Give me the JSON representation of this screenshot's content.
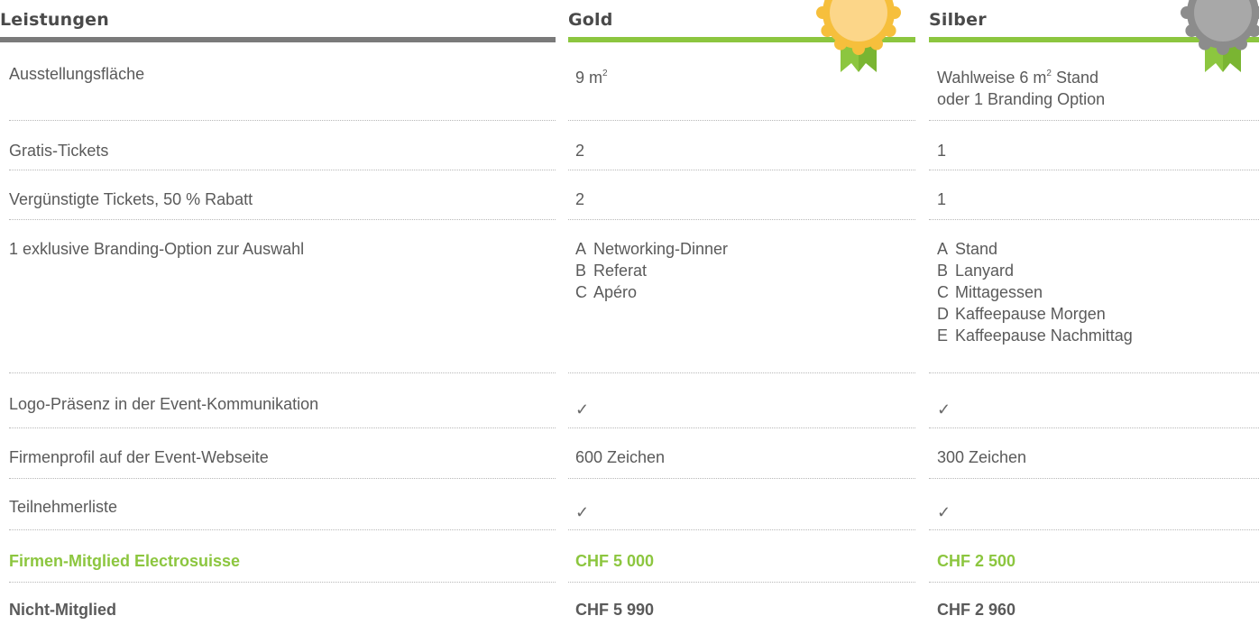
{
  "headers": {
    "leistungen": "Leistungen",
    "gold": "Gold",
    "silber": "Silber"
  },
  "colors": {
    "accent_green": "#8cc63f",
    "header_grey": "#7a7a7a",
    "gold_badge": "#f6bf3c",
    "silver_badge": "#9a9a9a"
  },
  "rows": {
    "flaeche": {
      "label": "Ausstellungsfläche",
      "gold_value": "9 m",
      "gold_sup": "2",
      "silber_line1_pre": "Wahlweise 6 m",
      "silber_sup": "2",
      "silber_line1_post": " Stand",
      "silber_line2": "oder 1 Branding Option"
    },
    "gratis": {
      "label": "Gratis-Tickets",
      "gold": "2",
      "silber": "1"
    },
    "verguenstigt": {
      "label": "Vergünstigte Tickets, 50 % Rabatt",
      "gold": "2",
      "silber": "1"
    },
    "branding": {
      "label": "1 exklusive Branding-Option zur Auswahl",
      "gold_options": [
        {
          "letter": "A",
          "text": "Networking-Dinner"
        },
        {
          "letter": "B",
          "text": "Referat"
        },
        {
          "letter": "C",
          "text": "Apéro"
        }
      ],
      "silber_options": [
        {
          "letter": "A",
          "text": "Stand"
        },
        {
          "letter": "B",
          "text": "Lanyard"
        },
        {
          "letter": "C",
          "text": "Mittagessen"
        },
        {
          "letter": "D",
          "text": "Kaffeepause Morgen"
        },
        {
          "letter": "E",
          "text": "Kaffeepause Nachmittag"
        }
      ]
    },
    "logo": {
      "label": "Logo-Präsenz in der Event-Kommunikation",
      "gold": "✓",
      "silber": "✓"
    },
    "profil": {
      "label": "Firmenprofil auf der Event-Webseite",
      "gold": "600 Zeichen",
      "silber": "300 Zeichen"
    },
    "teilnehmer": {
      "label": "Teilnehmerliste",
      "gold": "✓",
      "silber": "✓"
    },
    "mitglied": {
      "label": "Firmen-Mitglied Electrosuisse",
      "gold": "CHF 5 000",
      "silber": "CHF 2 500"
    },
    "nichtmitglied": {
      "label": "Nicht-Mitglied",
      "gold": "CHF 5 990",
      "silber": "CHF 2 960"
    }
  }
}
